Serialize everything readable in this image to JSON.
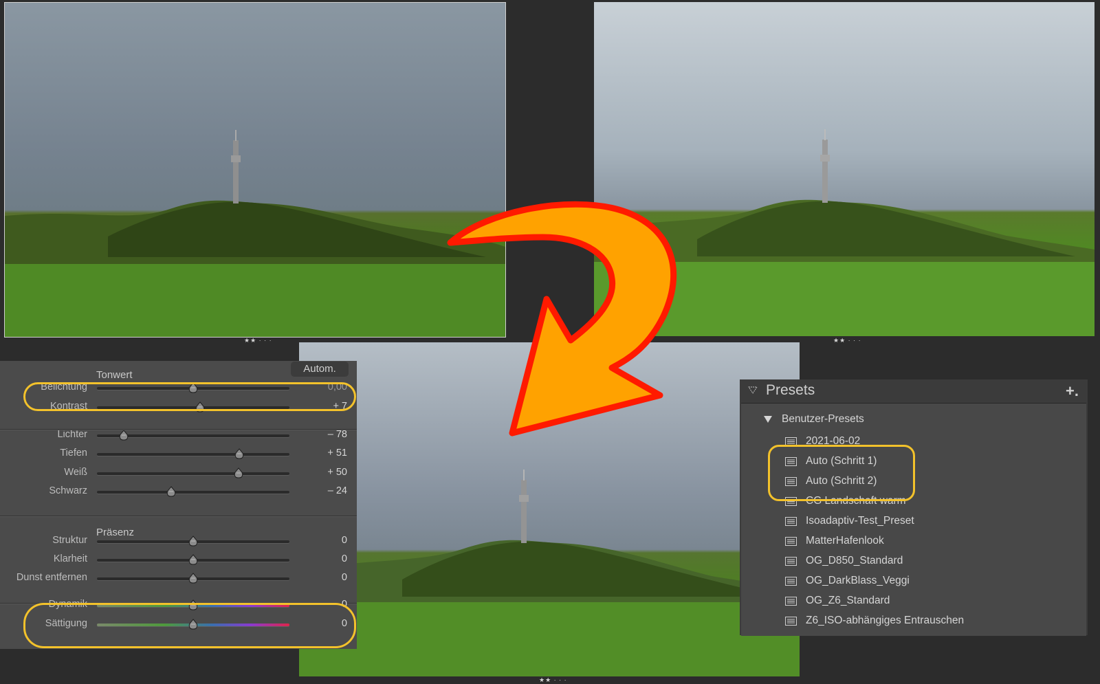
{
  "photos": {
    "before": {
      "rating": "★★ · · ·"
    },
    "auto_step1": {
      "rating": "★★ · · ·"
    },
    "auto_step2": {
      "rating": "★★ · · ·"
    }
  },
  "develop": {
    "tone_header": "Tonwert",
    "auto_label": "Autom.",
    "tone_sliders": [
      {
        "label": "Belichtung",
        "value": "0,00",
        "position": 0.5
      },
      {
        "label": "Kontrast",
        "value": "+ 7",
        "position": 0.535
      },
      {
        "label": "Lichter",
        "value": "– 78",
        "position": 0.14
      },
      {
        "label": "Tiefen",
        "value": "+ 51",
        "position": 0.74
      },
      {
        "label": "Weiß",
        "value": "+ 50",
        "position": 0.735
      },
      {
        "label": "Schwarz",
        "value": "– 24",
        "position": 0.385
      }
    ],
    "presence_header": "Präsenz",
    "presence_sliders": [
      {
        "label": "Struktur",
        "value": "0",
        "position": 0.5
      },
      {
        "label": "Klarheit",
        "value": "0",
        "position": 0.5
      },
      {
        "label": "Dunst entfernen",
        "value": "0",
        "position": 0.5
      },
      {
        "label": "Dynamik",
        "value": "0",
        "position": 0.5
      },
      {
        "label": "Sättigung",
        "value": "0",
        "position": 0.5
      }
    ]
  },
  "presets": {
    "title": "Presets",
    "add_icon": "+.",
    "folder": "Benutzer-Presets",
    "items": [
      "2021-06-02",
      "Auto (Schritt 1)",
      "Auto (Schritt 2)",
      "CG Landschaft warm",
      "Isoadaptiv-Test_Preset",
      "MatterHafenlook",
      "OG_D850_Standard",
      "OG_DarkBlass_Veggi",
      "OG_Z6_Standard",
      "Z6_ISO-abhängiges Entrauschen"
    ]
  },
  "colors": {
    "highlight": "#f3c22b",
    "arrow_fill": "#ffa200",
    "arrow_stroke": "#ff1a00",
    "panel_bg": "#4b4b4b"
  }
}
